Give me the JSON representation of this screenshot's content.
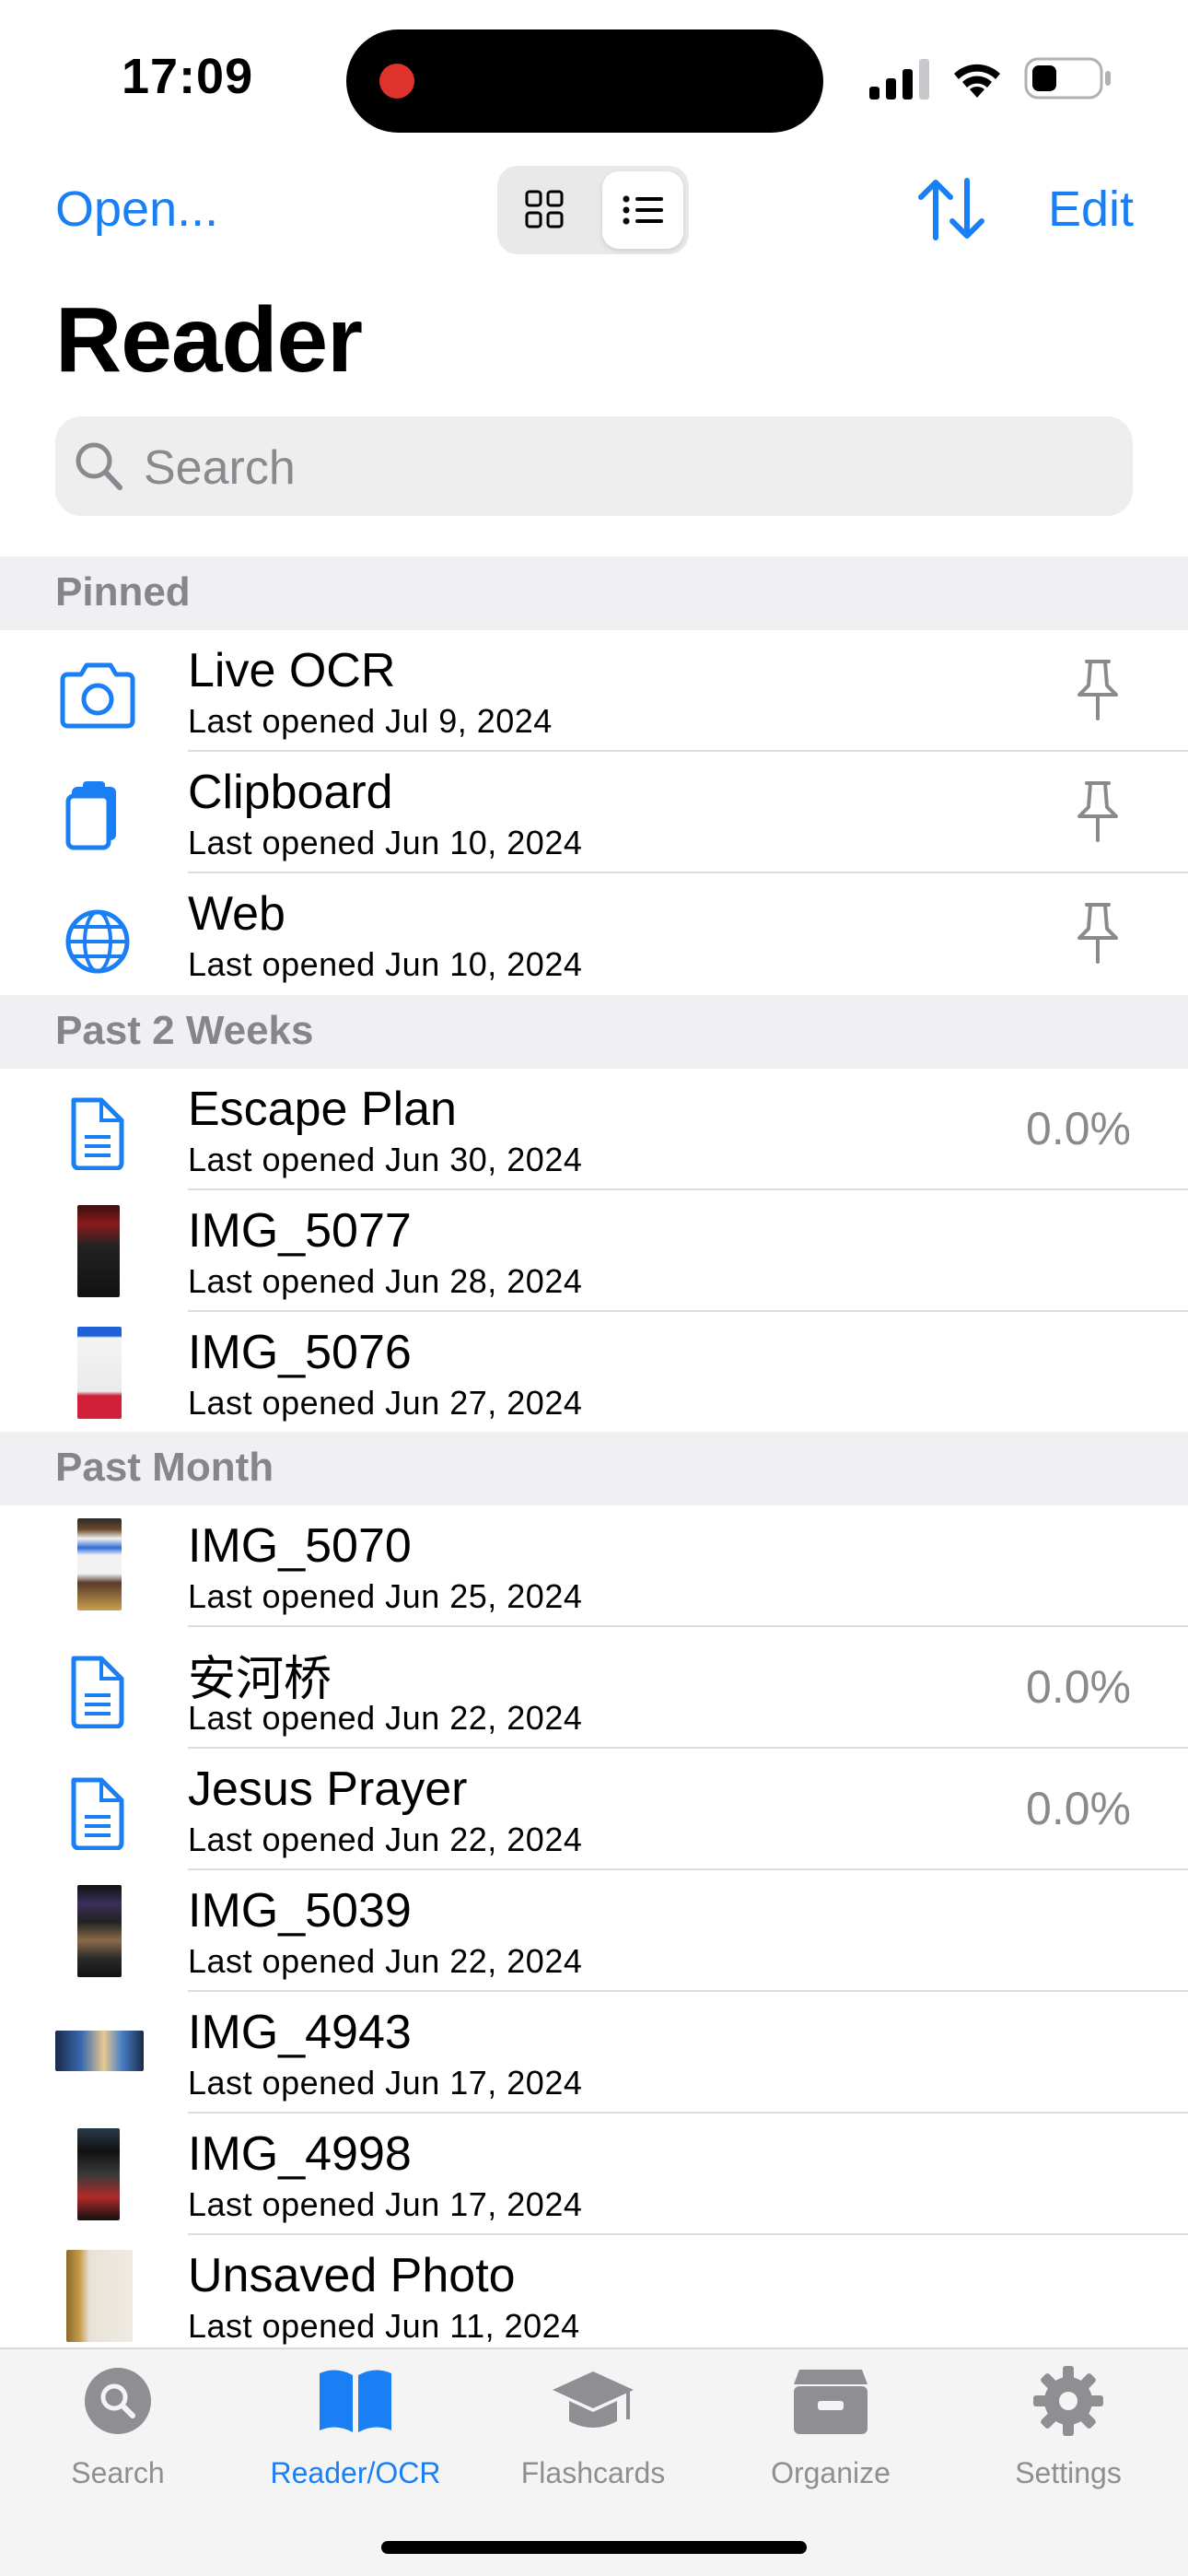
{
  "status_bar": {
    "time": "17:09"
  },
  "nav": {
    "open_label": "Open...",
    "edit_label": "Edit",
    "title": "Reader",
    "view_mode_selected": "list"
  },
  "search": {
    "placeholder": "Search"
  },
  "sections": [
    {
      "title": "Pinned"
    },
    {
      "title": "Past 2 Weeks"
    },
    {
      "title": "Past Month"
    }
  ],
  "pinned": [
    {
      "name": "Live OCR",
      "subtitle": "Last opened Jul 9, 2024",
      "icon": "camera-icon"
    },
    {
      "name": "Clipboard",
      "subtitle": "Last opened Jun 10, 2024",
      "icon": "clipboard-icon"
    },
    {
      "name": "Web",
      "subtitle": "Last opened Jun 10, 2024",
      "icon": "globe-icon"
    }
  ],
  "past_two_weeks": [
    {
      "name": "Escape Plan",
      "subtitle": "Last opened Jun 30, 2024",
      "progress": "0.0%",
      "icon": "document-icon"
    },
    {
      "name": "IMG_5077",
      "subtitle": "Last opened Jun 28, 2024",
      "icon": "photo-thumbnail"
    },
    {
      "name": "IMG_5076",
      "subtitle": "Last opened Jun 27, 2024",
      "icon": "photo-thumbnail"
    }
  ],
  "past_month": [
    {
      "name": "IMG_5070",
      "subtitle": "Last opened Jun 25, 2024",
      "icon": "photo-thumbnail"
    },
    {
      "name": "安河桥",
      "subtitle": "Last opened Jun 22, 2024",
      "progress": "0.0%",
      "icon": "document-icon"
    },
    {
      "name": "Jesus Prayer",
      "subtitle": "Last opened Jun 22, 2024",
      "progress": "0.0%",
      "icon": "document-icon"
    },
    {
      "name": "IMG_5039",
      "subtitle": "Last opened Jun 22, 2024",
      "icon": "photo-thumbnail"
    },
    {
      "name": "IMG_4943",
      "subtitle": "Last opened Jun 17, 2024",
      "icon": "photo-thumbnail"
    },
    {
      "name": "IMG_4998",
      "subtitle": "Last opened Jun 17, 2024",
      "icon": "photo-thumbnail"
    },
    {
      "name": "Unsaved Photo",
      "subtitle": "Last opened Jun 11, 2024",
      "icon": "photo-thumbnail"
    }
  ],
  "tabs": [
    {
      "label": "Search",
      "icon": "magnifier-icon",
      "active": false
    },
    {
      "label": "Reader/OCR",
      "icon": "book-icon",
      "active": true
    },
    {
      "label": "Flashcards",
      "icon": "graduation-cap-icon",
      "active": false
    },
    {
      "label": "Organize",
      "icon": "archive-box-icon",
      "active": false
    },
    {
      "label": "Settings",
      "icon": "gear-icon",
      "active": false
    }
  ],
  "colors": {
    "accent": "#1a7ff5",
    "secondary_text": "#8a8a8e",
    "section_bg": "#f0f0f2"
  }
}
